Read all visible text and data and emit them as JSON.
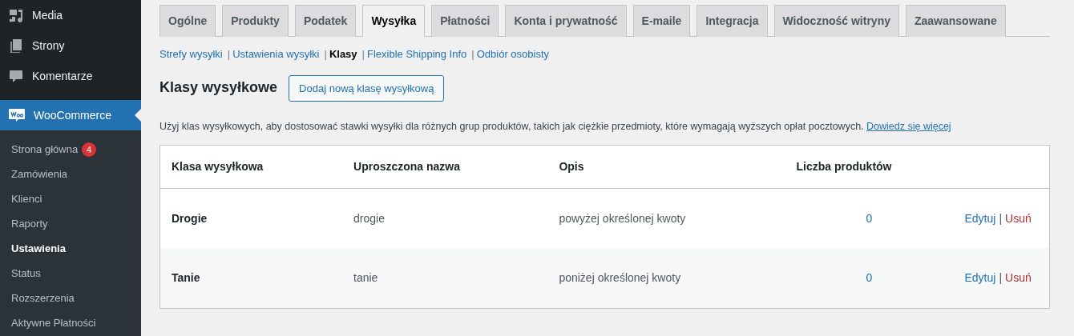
{
  "sidebar": {
    "items": [
      {
        "label": "Media",
        "kind": "media",
        "selected": false
      },
      {
        "label": "Strony",
        "kind": "pages",
        "selected": false
      },
      {
        "label": "Komentarze",
        "kind": "comments",
        "selected": false
      },
      {
        "label": "WooCommerce",
        "kind": "woo",
        "selected": true
      }
    ],
    "submenu": [
      {
        "label": "Strona główna",
        "badge": "4",
        "selected": false
      },
      {
        "label": "Zamówienia",
        "selected": false
      },
      {
        "label": "Klienci",
        "selected": false
      },
      {
        "label": "Raporty",
        "selected": false
      },
      {
        "label": "Ustawienia",
        "selected": true
      },
      {
        "label": "Status",
        "selected": false
      },
      {
        "label": "Rozszerzenia",
        "selected": false
      },
      {
        "label": "Aktywne Płatności",
        "selected": false
      }
    ]
  },
  "tabs": [
    {
      "label": "Ogólne",
      "selected": false
    },
    {
      "label": "Produkty",
      "selected": false
    },
    {
      "label": "Podatek",
      "selected": false
    },
    {
      "label": "Wysyłka",
      "selected": true
    },
    {
      "label": "Płatności",
      "selected": false
    },
    {
      "label": "Konta i prywatność",
      "selected": false
    },
    {
      "label": "E-maile",
      "selected": false
    },
    {
      "label": "Integracja",
      "selected": false
    },
    {
      "label": "Widoczność witryny",
      "selected": false
    },
    {
      "label": "Zaawansowane",
      "selected": false
    }
  ],
  "subnav": [
    {
      "label": "Strefy wysyłki",
      "selected": false
    },
    {
      "separator": "|",
      "label": "Ustawienia wysyłki",
      "selected": false
    },
    {
      "separator": "|",
      "label": "Klasy",
      "selected": true
    },
    {
      "separator": "|",
      "label": "Flexible Shipping Info",
      "selected": false
    },
    {
      "separator": "|",
      "label": "Odbiór osobisty",
      "selected": false
    }
  ],
  "heading": "Klasy wysyłkowe",
  "add_button": "Dodaj nową klasę wysyłkową",
  "description": "Użyj klas wysyłkowych, aby dostosować stawki wysyłki dla różnych grup produktów, takich jak ciężkie przedmioty, które wymagają wyższych opłat pocztowych.",
  "learn_more": "Dowiedz się więcej",
  "table": {
    "columns": [
      "Klasa wysyłkowa",
      "Uproszczona nazwa",
      "Opis",
      "Liczba produktów"
    ],
    "rows": [
      {
        "name": "Drogie",
        "slug": "drogie",
        "description": "powyżej określonej kwoty",
        "count": "0",
        "actions": [
          {
            "kind": "edit",
            "label": "Edytuj"
          },
          {
            "kind": "separator",
            "label": "|"
          },
          {
            "kind": "delete",
            "label": "Usuń"
          }
        ]
      },
      {
        "name": "Tanie",
        "slug": "tanie",
        "description": "poniżej określonej kwoty",
        "count": "0",
        "actions": [
          {
            "kind": "edit",
            "label": "Edytuj"
          },
          {
            "kind": "separator",
            "label": "|"
          },
          {
            "kind": "delete",
            "label": "Usuń"
          }
        ]
      }
    ]
  }
}
